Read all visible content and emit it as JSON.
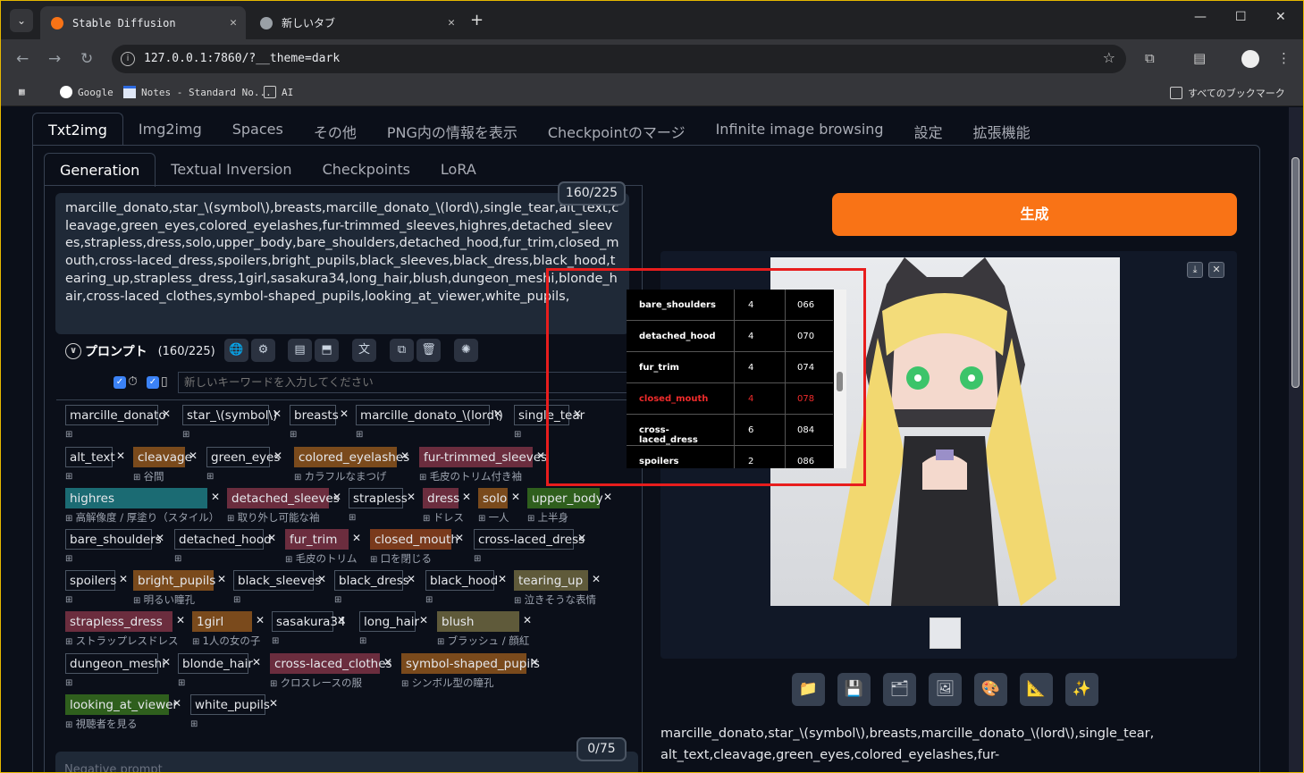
{
  "browser": {
    "tabs": [
      {
        "title": "Stable Diffusion",
        "active": true
      },
      {
        "title": "新しいタブ",
        "active": false
      }
    ],
    "url": "127.0.0.1:7860/?__theme=dark",
    "bookmarks": [
      "Google",
      "Notes - Standard No...",
      "AI"
    ],
    "all_bookmarks": "すべてのブックマーク"
  },
  "main_tabs": [
    "Txt2img",
    "Img2img",
    "Spaces",
    "その他",
    "PNG内の情報を表示",
    "Checkpointのマージ",
    "Infinite image browsing",
    "設定",
    "拡張機能"
  ],
  "sub_tabs": [
    "Generation",
    "Textual Inversion",
    "Checkpoints",
    "LoRA"
  ],
  "prompt": {
    "text": "marcille_donato,star_\\(symbol\\),breasts,marcille_donato_\\(lord\\),single_tear,alt_text,cleavage,green_eyes,colored_eyelashes,fur-trimmed_sleeves,highres,detached_sleeves,strapless,dress,solo,upper_body,bare_shoulders,detached_hood,fur_trim,closed_mouth,cross-laced_dress,spoilers,bright_pupils,black_sleeves,black_dress,black_hood,tearing_up,strapless_dress,1girl,sasakura34,long_hair,blush,dungeon_meshi,blonde_hair,cross-laced_clothes,symbol-shaped_pupils,looking_at_viewer,white_pupils,",
    "counter": "160/225",
    "section_title": "プロンプト",
    "section_count": "(160/225)",
    "keyword_placeholder": "新しいキーワードを入力してください"
  },
  "tags": [
    {
      "name": "marcille_donato",
      "trans": "",
      "color": ""
    },
    {
      "name": "star_\\(symbol\\)",
      "trans": "",
      "color": ""
    },
    {
      "name": "breasts",
      "trans": "",
      "color": ""
    },
    {
      "name": "marcille_donato_\\(lord\\)",
      "trans": "",
      "color": ""
    },
    {
      "name": "single_tear",
      "trans": "",
      "color": ""
    },
    {
      "name": "alt_text",
      "trans": "",
      "color": ""
    },
    {
      "name": "cleavage",
      "trans": "谷間",
      "color": "#7a4a1c"
    },
    {
      "name": "green_eyes",
      "trans": "",
      "color": ""
    },
    {
      "name": "colored_eyelashes",
      "trans": "カラフルなまつげ",
      "color": "#7a4a1c"
    },
    {
      "name": "fur-trimmed_sleeves",
      "trans": "毛皮のトリム付き袖",
      "color": "#6b2d3e"
    },
    {
      "name": "highres",
      "trans": "高解像度 / 厚塗り（スタイル）",
      "color": "#1b6b73"
    },
    {
      "name": "detached_sleeves",
      "trans": "取り外し可能な袖",
      "color": "#6b2d3e"
    },
    {
      "name": "strapless",
      "trans": "",
      "color": ""
    },
    {
      "name": "dress",
      "trans": "ドレス",
      "color": "#6b2d3e"
    },
    {
      "name": "solo",
      "trans": "一人",
      "color": "#7a4a1c"
    },
    {
      "name": "upper_body",
      "trans": "上半身",
      "color": "#2f5f1d"
    },
    {
      "name": "bare_shoulders",
      "trans": "",
      "color": ""
    },
    {
      "name": "detached_hood",
      "trans": "",
      "color": ""
    },
    {
      "name": "fur_trim",
      "trans": "毛皮のトリム",
      "color": "#6b2d3e"
    },
    {
      "name": "closed_mouth",
      "trans": "口を閉じる",
      "color": "#7a3a1c"
    },
    {
      "name": "cross-laced_dress",
      "trans": "",
      "color": ""
    },
    {
      "name": "spoilers",
      "trans": "",
      "color": ""
    },
    {
      "name": "bright_pupils",
      "trans": "明るい瞳孔",
      "color": "#7a4a1c"
    },
    {
      "name": "black_sleeves",
      "trans": "",
      "color": ""
    },
    {
      "name": "black_dress",
      "trans": "",
      "color": ""
    },
    {
      "name": "black_hood",
      "trans": "",
      "color": ""
    },
    {
      "name": "tearing_up",
      "trans": "泣きそうな表情",
      "color": "#5f5a3a"
    },
    {
      "name": "strapless_dress",
      "trans": "ストラップレスドレス",
      "color": "#6b2d3e"
    },
    {
      "name": "1girl",
      "trans": "1人の女の子",
      "color": "#7a4a1c"
    },
    {
      "name": "sasakura34",
      "trans": "",
      "color": ""
    },
    {
      "name": "long_hair",
      "trans": "",
      "color": ""
    },
    {
      "name": "blush",
      "trans": "ブラッシュ / 顔紅",
      "color": "#5f5a3a"
    },
    {
      "name": "dungeon_meshi",
      "trans": "",
      "color": ""
    },
    {
      "name": "blonde_hair",
      "trans": "",
      "color": ""
    },
    {
      "name": "cross-laced_clothes",
      "trans": "クロスレースの服",
      "color": "#6b2d3e"
    },
    {
      "name": "symbol-shaped_pupils",
      "trans": "シンボル型の瞳孔",
      "color": "#7a4a1c"
    },
    {
      "name": "looking_at_viewer",
      "trans": "視聴者を見る",
      "color": "#2f5f1d"
    },
    {
      "name": "white_pupils",
      "trans": "",
      "color": ""
    }
  ],
  "negative": {
    "placeholder": "Negative prompt",
    "counter": "0/75"
  },
  "generate_label": "生成",
  "output_text": "marcille_donato,star_\\(symbol\\),breasts,marcille_donato_\\(lord\\),single_tear,alt_text,cleavage,green_eyes,colored_eyelashes,fur-",
  "action_icons": [
    "folder-icon",
    "save-icon",
    "zip-icon",
    "image-icon",
    "palette-icon",
    "ruler-icon",
    "sparkle-icon"
  ],
  "popup": {
    "rows": [
      {
        "tag": "bare_shoulders",
        "count": "4",
        "pos": "066",
        "highlight": false
      },
      {
        "tag": "detached_hood",
        "count": "4",
        "pos": "070",
        "highlight": false
      },
      {
        "tag": "fur_trim",
        "count": "4",
        "pos": "074",
        "highlight": false
      },
      {
        "tag": "closed_mouth",
        "count": "4",
        "pos": "078",
        "highlight": true
      },
      {
        "tag": "cross-laced_dress",
        "count": "6",
        "pos": "084",
        "highlight": false
      },
      {
        "tag": "spoilers",
        "count": "2",
        "pos": "086",
        "highlight": false
      }
    ]
  },
  "colors": {
    "accent": "#f97316",
    "highlight_box": "#e81d1d",
    "background": "#0b0f19"
  }
}
